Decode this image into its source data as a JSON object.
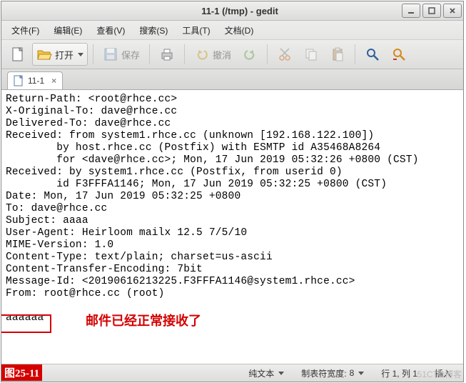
{
  "window": {
    "title": "11-1 (/tmp) - gedit"
  },
  "menubar": [
    "文件(F)",
    "编辑(E)",
    "查看(V)",
    "搜索(S)",
    "工具(T)",
    "文档(D)"
  ],
  "toolbar": {
    "new": {
      "icon": "new-doc"
    },
    "open_label": "打开",
    "save_label": "保存",
    "print": {
      "icon": "print"
    },
    "undo_label": "撤消"
  },
  "tab": {
    "name": "11-1"
  },
  "document": {
    "lines": [
      "Return-Path: <root@rhce.cc>",
      "X-Original-To: dave@rhce.cc",
      "Delivered-To: dave@rhce.cc",
      "Received: from system1.rhce.cc (unknown [192.168.122.100])",
      "        by host.rhce.cc (Postfix) with ESMTP id A35468A8264",
      "        for <dave@rhce.cc>; Mon, 17 Jun 2019 05:32:26 +0800 (CST)",
      "Received: by system1.rhce.cc (Postfix, from userid 0)",
      "        id F3FFFA1146; Mon, 17 Jun 2019 05:32:25 +0800 (CST)",
      "Date: Mon, 17 Jun 2019 05:32:25 +0800",
      "To: dave@rhce.cc",
      "Subject: aaaa",
      "User-Agent: Heirloom mailx 12.5 7/5/10",
      "MIME-Version: 1.0",
      "Content-Type: text/plain; charset=us-ascii",
      "Content-Transfer-Encoding: 7bit",
      "Message-Id: <20190616213225.F3FFFA1146@system1.rhce.cc>",
      "From: root@rhce.cc (root)",
      "",
      "aaaaaa"
    ]
  },
  "annotation": {
    "body_highlight": "aaaaaa",
    "note": "邮件已经正常接收了",
    "figure_label": "图25-11"
  },
  "statusbar": {
    "syntax": "纯文本",
    "tabwidth_label": "制表符宽度:",
    "tabwidth_value": "8",
    "position": "行 1, 列 1",
    "mode": "插入"
  },
  "watermark": "51CTO博客"
}
